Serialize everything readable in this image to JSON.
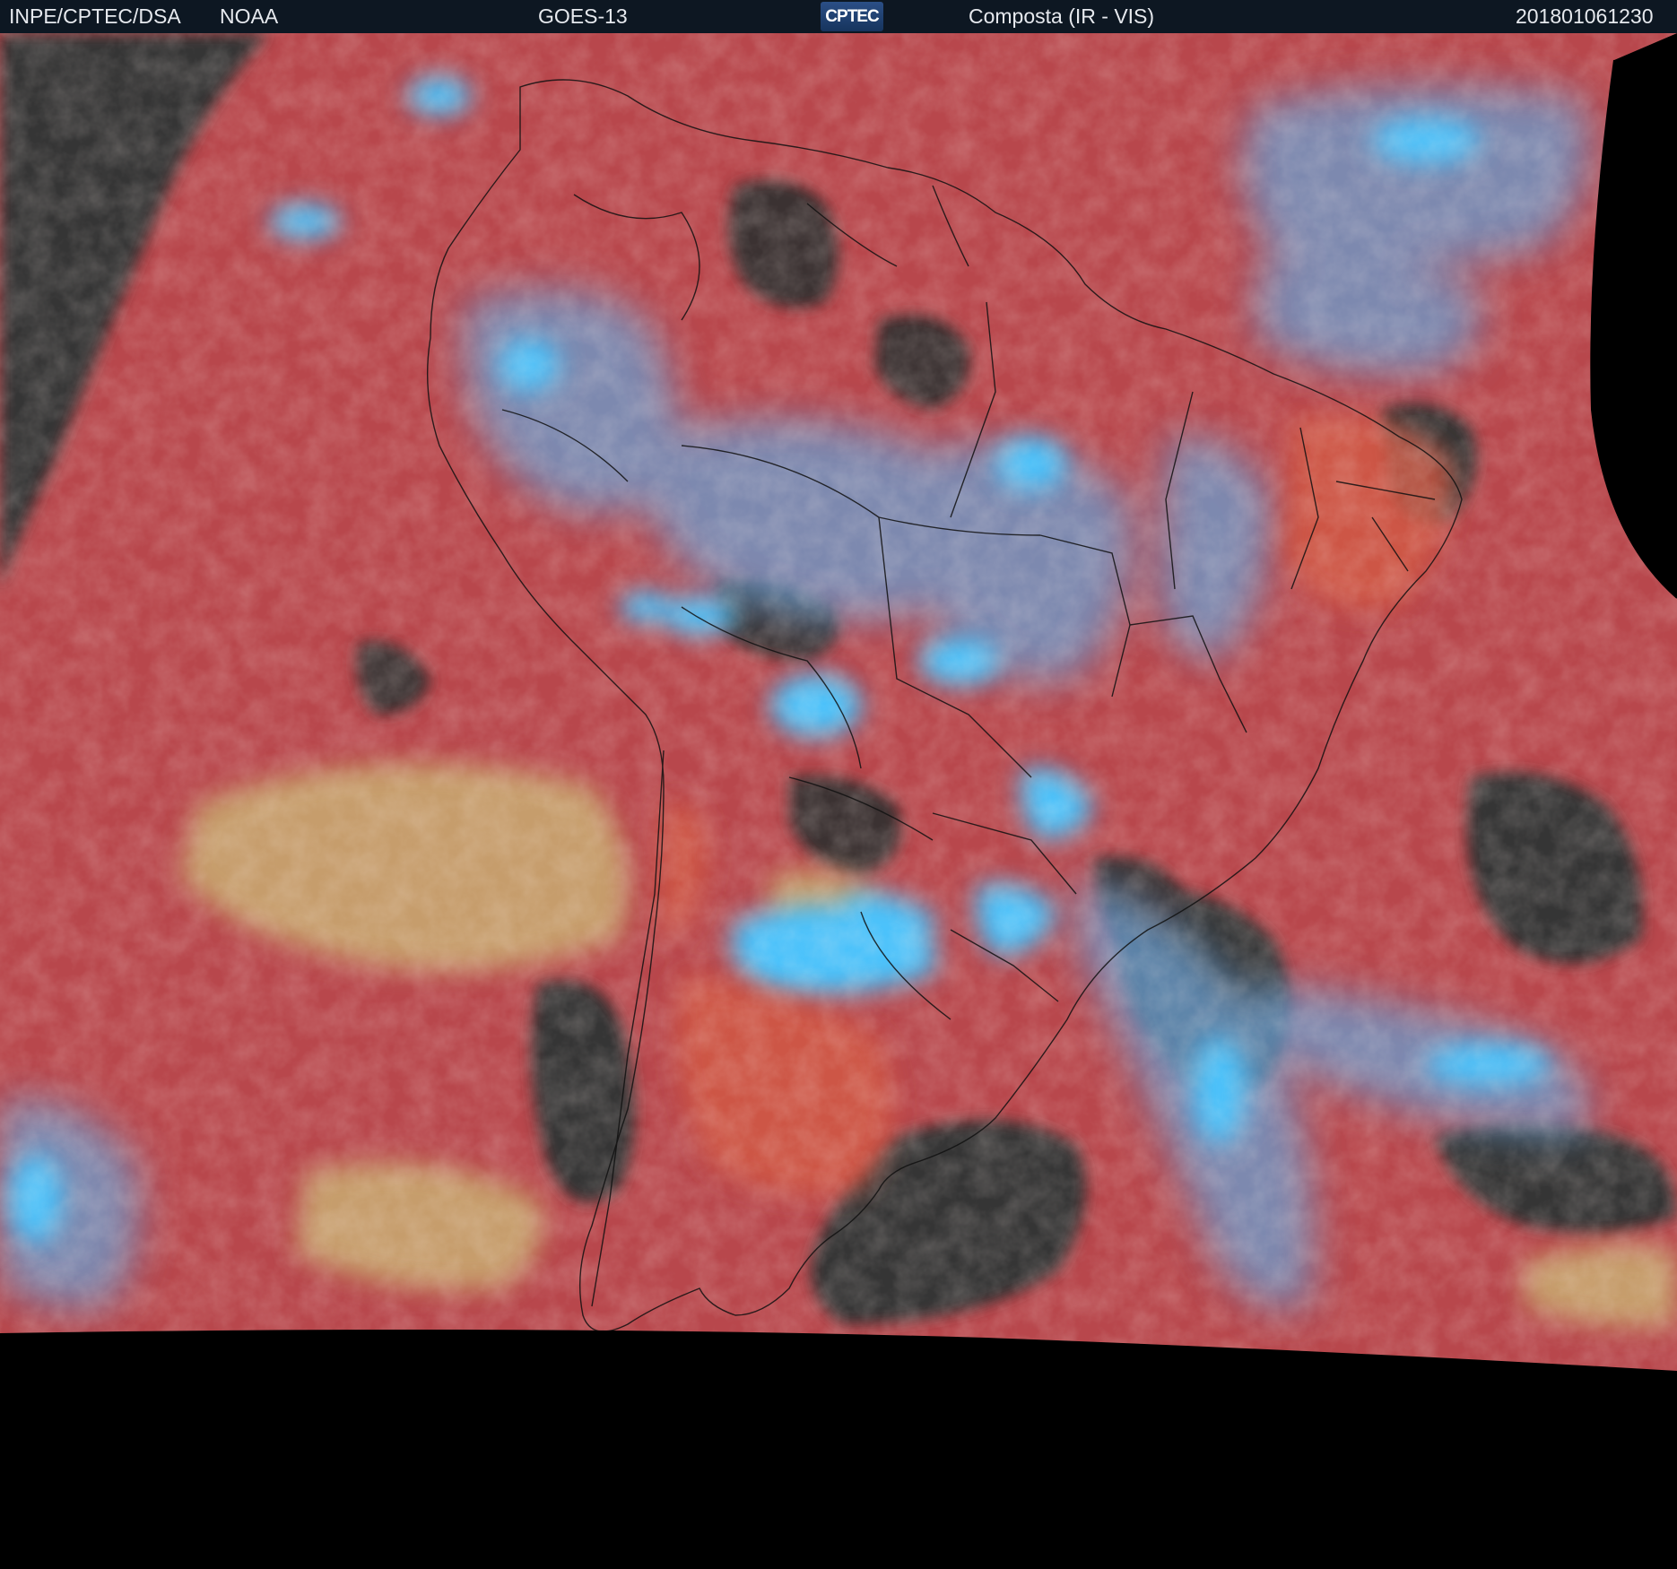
{
  "header": {
    "institution": "INPE/CPTEC/DSA",
    "agency": "NOAA",
    "satellite": "GOES-13",
    "logo_text": "CPTEC",
    "product": "Composta (IR - VIS)",
    "timestamp": "201801061230"
  },
  "colors": {
    "header_bg": "#0d1722",
    "ocean_dark": "#333333",
    "clear_land_red": "#c0464a",
    "low_cloud_yellow": "#c2a96b",
    "high_cloud_cyan": "#38b4f2",
    "deep_convection": "#4fbdf8",
    "no_data": "#000000"
  }
}
